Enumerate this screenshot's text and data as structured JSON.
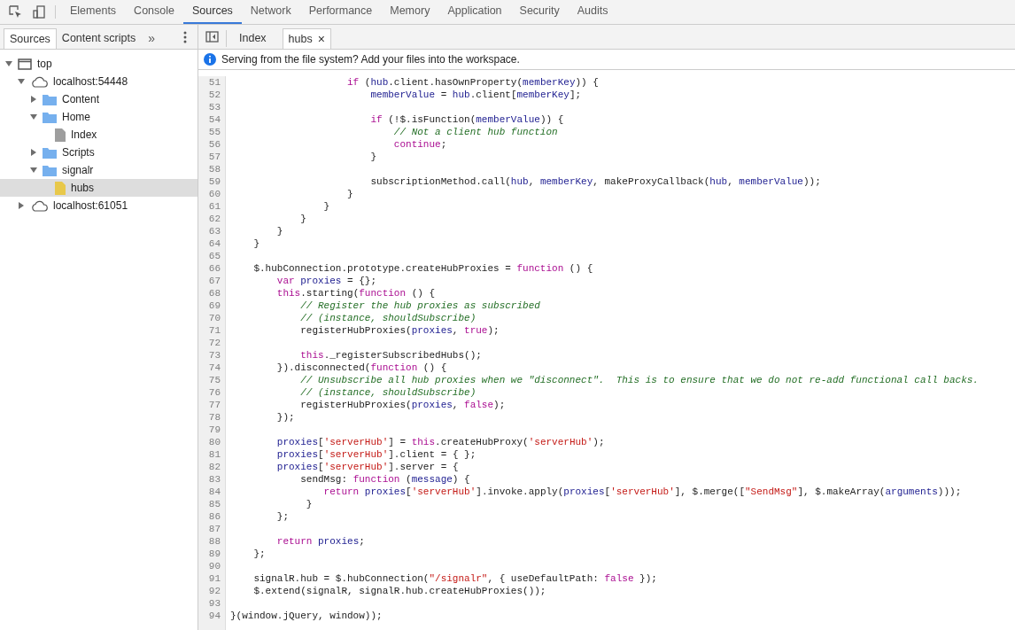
{
  "main_tabs": [
    {
      "label": "Elements",
      "selected": false
    },
    {
      "label": "Console",
      "selected": false
    },
    {
      "label": "Sources",
      "selected": true
    },
    {
      "label": "Network",
      "selected": false
    },
    {
      "label": "Performance",
      "selected": false
    },
    {
      "label": "Memory",
      "selected": false
    },
    {
      "label": "Application",
      "selected": false
    },
    {
      "label": "Security",
      "selected": false
    },
    {
      "label": "Audits",
      "selected": false
    }
  ],
  "sidebar": {
    "tabs": [
      {
        "label": "Sources",
        "selected": true
      },
      {
        "label": "Content scripts",
        "selected": false
      }
    ],
    "more": "»",
    "tree": [
      {
        "label": "top",
        "kind": "frame",
        "expanded": true,
        "selected": false,
        "children": [
          {
            "label": "localhost:54448",
            "kind": "host",
            "expanded": true,
            "selected": false,
            "children": [
              {
                "label": "Content",
                "kind": "folder",
                "expanded": false,
                "selected": false
              },
              {
                "label": "Home",
                "kind": "folder",
                "expanded": true,
                "selected": false,
                "children": [
                  {
                    "label": "Index",
                    "kind": "file",
                    "color": "#9e9e9e",
                    "selected": false
                  }
                ]
              },
              {
                "label": "Scripts",
                "kind": "folder",
                "expanded": false,
                "selected": false
              },
              {
                "label": "signalr",
                "kind": "folder",
                "expanded": true,
                "selected": false,
                "children": [
                  {
                    "label": "hubs",
                    "kind": "file",
                    "color": "#e8c84a",
                    "selected": true
                  }
                ]
              }
            ]
          },
          {
            "label": "localhost:61051",
            "kind": "host",
            "expanded": false,
            "selected": false
          }
        ]
      }
    ]
  },
  "editor_tabs": [
    {
      "label": "Index",
      "selected": false
    },
    {
      "label": "hubs",
      "selected": true,
      "close": "×"
    }
  ],
  "info_bar": "Serving from the file system? Add your files into the workspace.",
  "code_lines": [
    {
      "number": "51",
      "tokens": [
        {
          "kind": "keyword",
          "text": "                    if"
        },
        {
          "kind": "plain",
          "text": " ("
        },
        {
          "kind": "variable",
          "text": "hub"
        },
        {
          "kind": "plain",
          "text": ".client.hasOwnProperty("
        },
        {
          "kind": "variable",
          "text": "memberKey"
        },
        {
          "kind": "plain",
          "text": ")) {"
        }
      ]
    },
    {
      "number": "52",
      "tokens": [
        {
          "kind": "variable",
          "text": "                        memberValue"
        },
        {
          "kind": "plain",
          "text": " = "
        },
        {
          "kind": "variable",
          "text": "hub"
        },
        {
          "kind": "plain",
          "text": ".client["
        },
        {
          "kind": "variable",
          "text": "memberKey"
        },
        {
          "kind": "plain",
          "text": "];"
        }
      ]
    },
    {
      "number": "53"
    },
    {
      "number": "54",
      "tokens": [
        {
          "kind": "keyword",
          "text": "                        if"
        },
        {
          "kind": "plain",
          "text": " (!$.isFunction("
        },
        {
          "kind": "variable",
          "text": "memberValue"
        },
        {
          "kind": "plain",
          "text": ")) {"
        }
      ]
    },
    {
      "number": "55",
      "tokens": [
        {
          "kind": "comment",
          "text": "                            // Not a client hub function"
        }
      ]
    },
    {
      "number": "56",
      "tokens": [
        {
          "kind": "keyword",
          "text": "                            continue"
        },
        {
          "kind": "plain",
          "text": ";"
        }
      ]
    },
    {
      "number": "57",
      "tokens": [
        {
          "kind": "plain",
          "text": "                        }"
        }
      ]
    },
    {
      "number": "58"
    },
    {
      "number": "59",
      "tokens": [
        {
          "kind": "plain",
          "text": "                        subscriptionMethod.call("
        },
        {
          "kind": "variable",
          "text": "hub"
        },
        {
          "kind": "plain",
          "text": ", "
        },
        {
          "kind": "variable",
          "text": "memberKey"
        },
        {
          "kind": "plain",
          "text": ", makeProxyCallback("
        },
        {
          "kind": "variable",
          "text": "hub"
        },
        {
          "kind": "plain",
          "text": ", "
        },
        {
          "kind": "variable",
          "text": "memberValue"
        },
        {
          "kind": "plain",
          "text": "));"
        }
      ]
    },
    {
      "number": "60",
      "tokens": [
        {
          "kind": "plain",
          "text": "                    }"
        }
      ]
    },
    {
      "number": "61",
      "tokens": [
        {
          "kind": "plain",
          "text": "                }"
        }
      ]
    },
    {
      "number": "62",
      "tokens": [
        {
          "kind": "plain",
          "text": "            }"
        }
      ]
    },
    {
      "number": "63",
      "tokens": [
        {
          "kind": "plain",
          "text": "        }"
        }
      ]
    },
    {
      "number": "64",
      "tokens": [
        {
          "kind": "plain",
          "text": "    }"
        }
      ]
    },
    {
      "number": "65"
    },
    {
      "number": "66",
      "tokens": [
        {
          "kind": "plain",
          "text": "    $.hubConnection.prototype.createHubProxies = "
        },
        {
          "kind": "keyword",
          "text": "function"
        },
        {
          "kind": "plain",
          "text": " () {"
        }
      ]
    },
    {
      "number": "67",
      "tokens": [
        {
          "kind": "keyword",
          "text": "        var"
        },
        {
          "kind": "variable",
          "text": " proxies"
        },
        {
          "kind": "plain",
          "text": " = {};"
        }
      ]
    },
    {
      "number": "68",
      "tokens": [
        {
          "kind": "keyword",
          "text": "        this"
        },
        {
          "kind": "plain",
          "text": ".starting("
        },
        {
          "kind": "keyword",
          "text": "function"
        },
        {
          "kind": "plain",
          "text": " () {"
        }
      ]
    },
    {
      "number": "69",
      "tokens": [
        {
          "kind": "comment",
          "text": "            // Register the hub proxies as subscribed"
        }
      ]
    },
    {
      "number": "70",
      "tokens": [
        {
          "kind": "comment",
          "text": "            // (instance, shouldSubscribe)"
        }
      ]
    },
    {
      "number": "71",
      "tokens": [
        {
          "kind": "plain",
          "text": "            registerHubProxies("
        },
        {
          "kind": "variable",
          "text": "proxies"
        },
        {
          "kind": "plain",
          "text": ", "
        },
        {
          "kind": "keyword",
          "text": "true"
        },
        {
          "kind": "plain",
          "text": ");"
        }
      ]
    },
    {
      "number": "72"
    },
    {
      "number": "73",
      "tokens": [
        {
          "kind": "keyword",
          "text": "            this"
        },
        {
          "kind": "plain",
          "text": "._registerSubscribedHubs();"
        }
      ]
    },
    {
      "number": "74",
      "tokens": [
        {
          "kind": "plain",
          "text": "        }).disconnected("
        },
        {
          "kind": "keyword",
          "text": "function"
        },
        {
          "kind": "plain",
          "text": " () {"
        }
      ]
    },
    {
      "number": "75",
      "tokens": [
        {
          "kind": "comment",
          "text": "            // Unsubscribe all hub proxies when we \"disconnect\".  This is to ensure that we do not re-add functional call backs."
        }
      ]
    },
    {
      "number": "76",
      "tokens": [
        {
          "kind": "comment",
          "text": "            // (instance, shouldSubscribe)"
        }
      ]
    },
    {
      "number": "77",
      "tokens": [
        {
          "kind": "plain",
          "text": "            registerHubProxies("
        },
        {
          "kind": "variable",
          "text": "proxies"
        },
        {
          "kind": "plain",
          "text": ", "
        },
        {
          "kind": "keyword",
          "text": "false"
        },
        {
          "kind": "plain",
          "text": ");"
        }
      ]
    },
    {
      "number": "78",
      "tokens": [
        {
          "kind": "plain",
          "text": "        });"
        }
      ]
    },
    {
      "number": "79"
    },
    {
      "number": "80",
      "tokens": [
        {
          "kind": "variable",
          "text": "        proxies"
        },
        {
          "kind": "plain",
          "text": "["
        },
        {
          "kind": "string",
          "text": "'serverHub'"
        },
        {
          "kind": "plain",
          "text": "] = "
        },
        {
          "kind": "keyword",
          "text": "this"
        },
        {
          "kind": "plain",
          "text": ".createHubProxy("
        },
        {
          "kind": "string",
          "text": "'serverHub'"
        },
        {
          "kind": "plain",
          "text": ");"
        }
      ]
    },
    {
      "number": "81",
      "tokens": [
        {
          "kind": "variable",
          "text": "        proxies"
        },
        {
          "kind": "plain",
          "text": "["
        },
        {
          "kind": "string",
          "text": "'serverHub'"
        },
        {
          "kind": "plain",
          "text": "].client = { };"
        }
      ]
    },
    {
      "number": "82",
      "tokens": [
        {
          "kind": "variable",
          "text": "        proxies"
        },
        {
          "kind": "plain",
          "text": "["
        },
        {
          "kind": "string",
          "text": "'serverHub'"
        },
        {
          "kind": "plain",
          "text": "].server = {"
        }
      ]
    },
    {
      "number": "83",
      "tokens": [
        {
          "kind": "plain",
          "text": "            sendMsg: "
        },
        {
          "kind": "keyword",
          "text": "function"
        },
        {
          "kind": "plain",
          "text": " ("
        },
        {
          "kind": "variable",
          "text": "message"
        },
        {
          "kind": "plain",
          "text": ") {"
        }
      ]
    },
    {
      "number": "84",
      "tokens": [
        {
          "kind": "keyword",
          "text": "                return"
        },
        {
          "kind": "variable",
          "text": " proxies"
        },
        {
          "kind": "plain",
          "text": "["
        },
        {
          "kind": "string",
          "text": "'serverHub'"
        },
        {
          "kind": "plain",
          "text": "].invoke.apply("
        },
        {
          "kind": "variable",
          "text": "proxies"
        },
        {
          "kind": "plain",
          "text": "["
        },
        {
          "kind": "string",
          "text": "'serverHub'"
        },
        {
          "kind": "plain",
          "text": "], $.merge(["
        },
        {
          "kind": "string",
          "text": "\"SendMsg\""
        },
        {
          "kind": "plain",
          "text": "], $.makeArray("
        },
        {
          "kind": "variable",
          "text": "arguments"
        },
        {
          "kind": "plain",
          "text": ")));"
        }
      ]
    },
    {
      "number": "85",
      "tokens": [
        {
          "kind": "plain",
          "text": "             }"
        }
      ]
    },
    {
      "number": "86",
      "tokens": [
        {
          "kind": "plain",
          "text": "        };"
        }
      ]
    },
    {
      "number": "87"
    },
    {
      "number": "88",
      "tokens": [
        {
          "kind": "keyword",
          "text": "        return"
        },
        {
          "kind": "variable",
          "text": " proxies"
        },
        {
          "kind": "plain",
          "text": ";"
        }
      ]
    },
    {
      "number": "89",
      "tokens": [
        {
          "kind": "plain",
          "text": "    };"
        }
      ]
    },
    {
      "number": "90"
    },
    {
      "number": "91",
      "tokens": [
        {
          "kind": "plain",
          "text": "    signalR.hub = $.hubConnection("
        },
        {
          "kind": "string",
          "text": "\"/signalr\""
        },
        {
          "kind": "plain",
          "text": ", { useDefaultPath: "
        },
        {
          "kind": "keyword",
          "text": "false"
        },
        {
          "kind": "plain",
          "text": " });"
        }
      ]
    },
    {
      "number": "92",
      "tokens": [
        {
          "kind": "plain",
          "text": "    $.extend(signalR, signalR.hub.createHubProxies());"
        }
      ]
    },
    {
      "number": "93"
    },
    {
      "number": "94",
      "tokens": [
        {
          "kind": "plain",
          "text": "}(window.jQuery, window));"
        }
      ]
    }
  ]
}
